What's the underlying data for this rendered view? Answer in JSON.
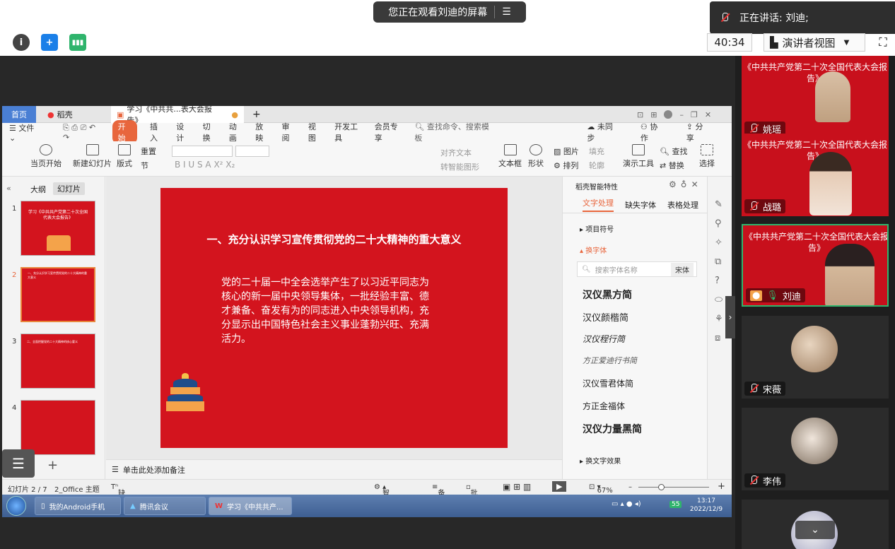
{
  "meeting": {
    "share_banner": "您正在观看刘迪的屏幕",
    "speaking": "正在讲话: 刘迪;",
    "timer": "40:34",
    "view_mode": "演讲者视图"
  },
  "wps": {
    "tabs": [
      "首页",
      "稻壳",
      "学习《中共共...表大会报告》"
    ],
    "menus": [
      "文件",
      "开始",
      "插入",
      "设计",
      "切换",
      "动画",
      "放映",
      "审阅",
      "视图",
      "开发工具",
      "会员专享"
    ],
    "search_placeholder": "查找命令、搜索模板",
    "unsynced": "未同步",
    "collab": "协作",
    "share": "分享",
    "ribbon": {
      "from_start": "当页开始",
      "new_slide": "新建幻灯片",
      "layout": "版式",
      "section": "节",
      "reset": "重置",
      "textbox": "文本框",
      "shape": "形状",
      "picture": "图片",
      "arrange": "排列",
      "fill": "填充",
      "outline": "轮廓",
      "present_tools": "演示工具",
      "find": "查找",
      "replace": "替换",
      "select": "选择",
      "align_text": "对齐文本",
      "smart_art": "转智能图形"
    },
    "panel_tabs": {
      "outline": "大纲",
      "slides": "幻灯片"
    },
    "thumbs": [
      {
        "num": "1",
        "title": "学习《中共共产党第二十次全国代表大会报告》"
      },
      {
        "num": "2",
        "title": "一、充分认识学习宣传贯彻党的二十大精神的重大意义"
      },
      {
        "num": "3",
        "title": "二、全面把握党的二十大精神的核心要义"
      },
      {
        "num": "4",
        "title": ""
      }
    ],
    "slide": {
      "title": "一、充分认识学习宣传贯彻党的二十大精神的重大意义",
      "body": "党的二十届一中全会选举产生了以习近平同志为核心的新一届中央领导集体，一批经验丰富、德才兼备、奋发有为的同志进入中央领导机构，充分显示出中国特色社会主义事业蓬勃兴旺、充满活力。"
    },
    "notes_placeholder": "单击此处添加备注",
    "font_panel": {
      "title": "稻壳智能特性",
      "tabs": [
        "文字处理",
        "缺失字体",
        "表格处理"
      ],
      "item_symbols": "项目符号",
      "item_font": "换字体",
      "search_placeholder": "搜索字体名称",
      "current_font": "宋体",
      "fonts": [
        "汉仪黑方简",
        "汉仪颜楷简",
        "汉仪程行简",
        "方正爱迪行书简",
        "汉仪雪君体简",
        "方正金福体",
        "汉仪力量黑简"
      ],
      "effects": "换文字效果"
    },
    "status": {
      "slide_count": "幻灯片 2 / 7",
      "theme": "2_Office 主题",
      "missing_font": "缺失字体",
      "beautify": "智能美化",
      "notes": "备注",
      "comments": "批注",
      "zoom": "67%"
    }
  },
  "taskbar": {
    "items": [
      "我的Android手机",
      "腾讯会议",
      "学习《中共共产..."
    ],
    "time": "13:17",
    "date": "2022/12/9",
    "badge": "55"
  },
  "participants": [
    {
      "name": "姚瑶",
      "muted": true,
      "slide_title": "《中共共产党第二十次全国代表大会报告》"
    },
    {
      "name": "战璐",
      "muted": true,
      "slide_title": "《中共共产党第二十次全国代表大会报告》"
    },
    {
      "name": "刘迪",
      "muted": false,
      "slide_title": "《中共共产党第二十次全国代表大会报告》"
    },
    {
      "name": "宋薇",
      "muted": true,
      "slide_title": ""
    },
    {
      "name": "李伟",
      "muted": true,
      "slide_title": ""
    }
  ],
  "colors": {
    "slide_red": "#d3141e",
    "accent_orange": "#e8663d",
    "active_green": "#2fb46c"
  }
}
